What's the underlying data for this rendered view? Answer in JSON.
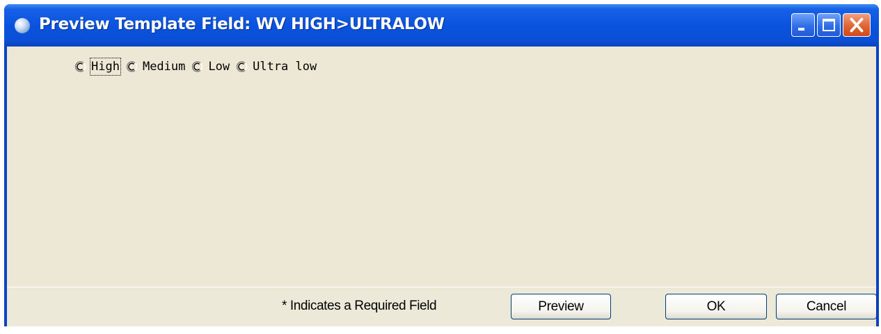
{
  "window": {
    "title": "Preview Template Field: WV HIGH>ULTRALOW"
  },
  "radio_options": [
    {
      "label": "High",
      "selected": false,
      "focused": true
    },
    {
      "label": "Medium",
      "selected": false,
      "focused": false
    },
    {
      "label": "Low",
      "selected": false,
      "focused": false
    },
    {
      "label": "Ultra low",
      "selected": false,
      "focused": false
    }
  ],
  "footer": {
    "required_note": "* Indicates a Required Field",
    "preview_label": "Preview",
    "ok_label": "OK",
    "cancel_label": "Cancel"
  },
  "icons": {
    "app": "globe-icon",
    "minimize": "minimize-icon",
    "maximize": "maximize-icon",
    "close": "close-icon",
    "radio": "radio-unchecked-icon"
  },
  "colors": {
    "titlebar": "#0a53de",
    "client_bg": "#ede8d6",
    "close_button": "#e06432"
  }
}
